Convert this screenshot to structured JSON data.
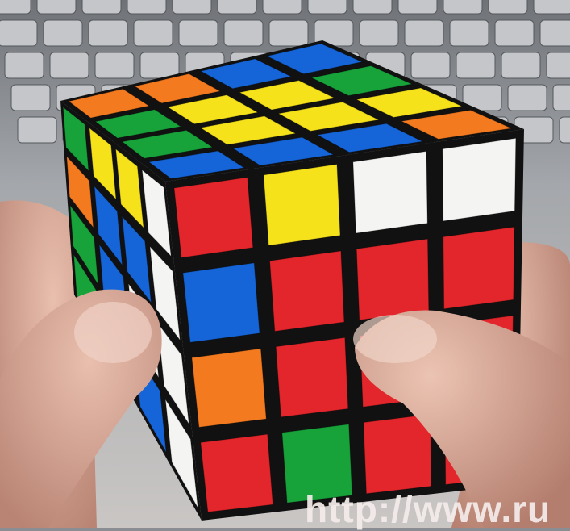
{
  "watermark": "http://www.ru",
  "colors": {
    "red": "#e2262b",
    "orange": "#f47a1f",
    "yellow": "#f5e21a",
    "green": "#17a33a",
    "blue": "#1565d8",
    "white": "#f4f4f2",
    "body": "#111111",
    "skin": "#d9a08c"
  },
  "cube": {
    "top": [
      [
        "orange",
        "orange",
        "blue",
        "blue"
      ],
      [
        "green",
        "yellow",
        "yellow",
        "green"
      ],
      [
        "green",
        "yellow",
        "yellow",
        "yellow"
      ],
      [
        "blue",
        "blue",
        "blue",
        "orange"
      ]
    ],
    "left": [
      [
        "green",
        "yellow",
        "yellow",
        "white"
      ],
      [
        "orange",
        "blue",
        "blue",
        "white"
      ],
      [
        "green",
        "blue",
        "white",
        "white"
      ],
      [
        "green",
        "blue",
        "blue",
        "white"
      ]
    ],
    "front": [
      [
        "red",
        "yellow",
        "white",
        "white"
      ],
      [
        "blue",
        "red",
        "red",
        "red"
      ],
      [
        "orange",
        "red",
        "red",
        "red"
      ],
      [
        "red",
        "green",
        "red",
        "red"
      ]
    ]
  }
}
